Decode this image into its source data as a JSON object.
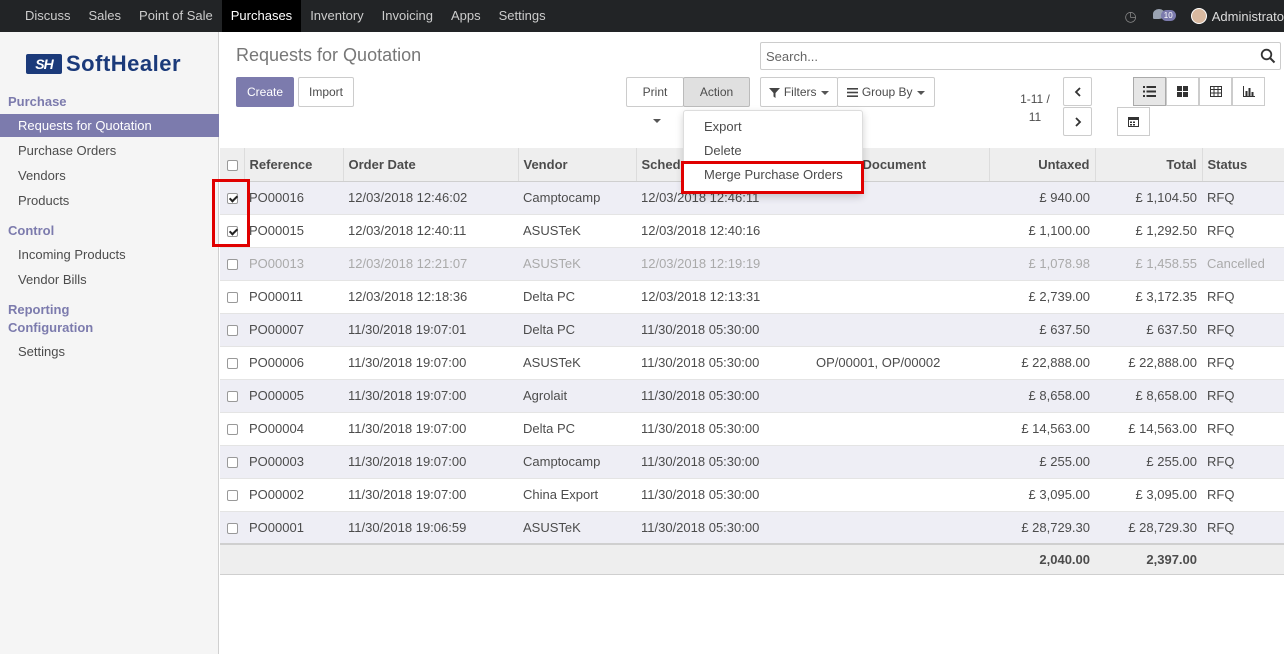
{
  "navbar": {
    "menus": [
      "Discuss",
      "Sales",
      "Point of Sale",
      "Purchases",
      "Inventory",
      "Invoicing",
      "Apps",
      "Settings"
    ],
    "active": "Purchases",
    "chat_count": "10",
    "user": "Administrato"
  },
  "logo": {
    "mark": "SH",
    "text": "SoftHealer"
  },
  "sidebar": {
    "purchase_heading": "Purchase",
    "purchase_items": [
      "Requests for Quotation",
      "Purchase Orders",
      "Vendors",
      "Products"
    ],
    "control_heading": "Control",
    "control_items": [
      "Incoming Products",
      "Vendor Bills"
    ],
    "reporting_heading": "Reporting",
    "configuration_heading": "Configuration",
    "configuration_items": [
      "Settings"
    ]
  },
  "page": {
    "title": "Requests for Quotation"
  },
  "buttons": {
    "create": "Create",
    "import": "Import",
    "print": "Print",
    "action": "Action",
    "filters": "Filters",
    "group_by": "Group By"
  },
  "search": {
    "placeholder": "Search..."
  },
  "pager": {
    "value": "1-11 /",
    "total": "11"
  },
  "action_menu": [
    "Export",
    "Delete",
    "Merge Purchase Orders"
  ],
  "table": {
    "columns": [
      "Reference",
      "Order Date",
      "Vendor",
      "Sched",
      "Document",
      "Untaxed",
      "Total",
      "Status"
    ],
    "rows": [
      {
        "checked": true,
        "ref": "PO00016",
        "order_date": "12/03/2018 12:46:02",
        "vendor": "Camptocamp",
        "scheduled": "12/03/2018 12:46:11",
        "document": "",
        "untaxed": "£ 940.00",
        "total": "£ 1,104.50",
        "status": "RFQ"
      },
      {
        "checked": true,
        "ref": "PO00015",
        "order_date": "12/03/2018 12:40:11",
        "vendor": "ASUSTeK",
        "scheduled": "12/03/2018 12:40:16",
        "document": "",
        "untaxed": "£ 1,100.00",
        "total": "£ 1,292.50",
        "status": "RFQ"
      },
      {
        "checked": false,
        "ref": "PO00013",
        "order_date": "12/03/2018 12:21:07",
        "vendor": "ASUSTeK",
        "scheduled": "12/03/2018 12:19:19",
        "document": "",
        "untaxed": "£ 1,078.98",
        "total": "£ 1,458.55",
        "status": "Cancelled",
        "muted": true
      },
      {
        "checked": false,
        "ref": "PO00011",
        "order_date": "12/03/2018 12:18:36",
        "vendor": "Delta PC",
        "scheduled": "12/03/2018 12:13:31",
        "document": "",
        "untaxed": "£ 2,739.00",
        "total": "£ 3,172.35",
        "status": "RFQ"
      },
      {
        "checked": false,
        "ref": "PO00007",
        "order_date": "11/30/2018 19:07:01",
        "vendor": "Delta PC",
        "scheduled": "11/30/2018 05:30:00",
        "document": "",
        "untaxed": "£ 637.50",
        "total": "£ 637.50",
        "status": "RFQ"
      },
      {
        "checked": false,
        "ref": "PO00006",
        "order_date": "11/30/2018 19:07:00",
        "vendor": "ASUSTeK",
        "scheduled": "11/30/2018 05:30:00",
        "document": "OP/00001, OP/00002",
        "untaxed": "£ 22,888.00",
        "total": "£ 22,888.00",
        "status": "RFQ"
      },
      {
        "checked": false,
        "ref": "PO00005",
        "order_date": "11/30/2018 19:07:00",
        "vendor": "Agrolait",
        "scheduled": "11/30/2018 05:30:00",
        "document": "",
        "untaxed": "£ 8,658.00",
        "total": "£ 8,658.00",
        "status": "RFQ"
      },
      {
        "checked": false,
        "ref": "PO00004",
        "order_date": "11/30/2018 19:07:00",
        "vendor": "Delta PC",
        "scheduled": "11/30/2018 05:30:00",
        "document": "",
        "untaxed": "£ 14,563.00",
        "total": "£ 14,563.00",
        "status": "RFQ"
      },
      {
        "checked": false,
        "ref": "PO00003",
        "order_date": "11/30/2018 19:07:00",
        "vendor": "Camptocamp",
        "scheduled": "11/30/2018 05:30:00",
        "document": "",
        "untaxed": "£ 255.00",
        "total": "£ 255.00",
        "status": "RFQ"
      },
      {
        "checked": false,
        "ref": "PO00002",
        "order_date": "11/30/2018 19:07:00",
        "vendor": "China Export",
        "scheduled": "11/30/2018 05:30:00",
        "document": "",
        "untaxed": "£ 3,095.00",
        "total": "£ 3,095.00",
        "status": "RFQ"
      },
      {
        "checked": false,
        "ref": "PO00001",
        "order_date": "11/30/2018 19:06:59",
        "vendor": "ASUSTeK",
        "scheduled": "11/30/2018 05:30:00",
        "document": "",
        "untaxed": "£ 28,729.30",
        "total": "£ 28,729.30",
        "status": "RFQ"
      }
    ],
    "totals": {
      "untaxed": "2,040.00",
      "total": "2,397.00"
    }
  },
  "colors": {
    "accent": "#7c7bad",
    "navbar": "#222426",
    "highlight_box": "#e00000"
  }
}
